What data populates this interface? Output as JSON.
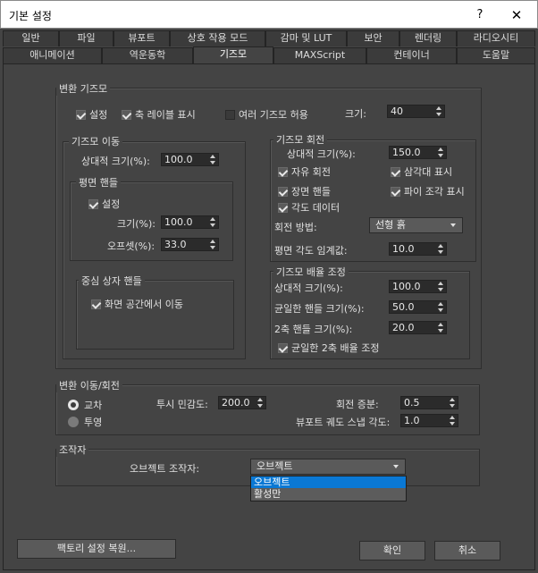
{
  "window": {
    "title": "기본 설정",
    "help_glyph": "?",
    "close_glyph": "✕"
  },
  "tabs_row1": [
    "일반",
    "파일",
    "뷰포트",
    "상호 작용 모드",
    "감마 및 LUT",
    "보안",
    "렌더링",
    "라디오시티"
  ],
  "tabs_row2": [
    "애니메이션",
    "역운동학",
    "기즈모",
    "MAXScript",
    "컨테이너",
    "도움말"
  ],
  "active_tab": "기즈모",
  "transform_gizmo": {
    "label": "변환 기즈모",
    "on_label": "설정",
    "on_checked": true,
    "axis_labels_label": "축 레이블 표시",
    "axis_labels_checked": true,
    "multiple_label": "여러 기즈모 허용",
    "multiple_checked": false,
    "size_label": "크기:",
    "size_value": "40"
  },
  "move_gizmo": {
    "label": "기즈모 이동",
    "relative_size_label": "상대적 크기(%):",
    "relative_size_value": "100.0",
    "plane_handles": {
      "label": "평면 핸들",
      "on_label": "설정",
      "on_checked": true,
      "size_label": "크기(%):",
      "size_value": "100.0",
      "offset_label": "오프셋(%):",
      "offset_value": "33.0"
    },
    "center_box": {
      "label": "중심 상자 핸들",
      "screen_space_label": "화면 공간에서 이동",
      "screen_space_checked": true
    }
  },
  "rotate_gizmo": {
    "label": "기즈모 회전",
    "relative_size_label": "상대적 크기(%):",
    "relative_size_value": "150.0",
    "free_rotation_label": "자유 회전",
    "free_rotation_checked": true,
    "show_triangle_label": "삼각대 표시",
    "show_triangle_checked": true,
    "screen_handle_label": "장면 핸들",
    "screen_handle_checked": true,
    "show_pie_label": "파이 조각 표시",
    "show_pie_checked": true,
    "angle_data_label": "각도 데이터",
    "angle_data_checked": true,
    "method_label": "회전 방법:",
    "method_value": "선형 흙",
    "plane_threshold_label": "평면 각도 임계값:",
    "plane_threshold_value": "10.0"
  },
  "scale_gizmo": {
    "label": "기즈모 배율 조정",
    "relative_size_label": "상대적 크기(%):",
    "relative_size_value": "100.0",
    "uniform_handle_label": "균일한 핸들 크기(%):",
    "uniform_handle_value": "50.0",
    "biaxial_handle_label": "2축 핸들 크기(%):",
    "biaxial_handle_value": "20.0",
    "uniform_biaxial_label": "균일한 2축 배율 조정",
    "uniform_biaxial_checked": true
  },
  "move_rotate_transforms": {
    "label": "변환 이동/회전",
    "intersection_label": "교차",
    "intersection_selected": true,
    "projection_label": "투영",
    "projection_selected": false,
    "perspective_sensitivity_label": "투시 민감도:",
    "perspective_sensitivity_value": "200.0",
    "rotation_increment_label": "회전 증분:",
    "rotation_increment_value": "0.5",
    "viewport_arc_snap_label": "뷰포트 궤도 스냅 각도:",
    "viewport_arc_snap_value": "1.0"
  },
  "manipulators": {
    "label": "조작자",
    "object_manipulators_label": "오브젝트 조작자:",
    "object_manipulators_value": "오브젝트",
    "options": [
      "오브젝트",
      "활성만"
    ],
    "highlighted_option": "오브젝트"
  },
  "buttons": {
    "revert_label": "팩토리 설정 복원...",
    "ok_label": "확인",
    "cancel_label": "취소"
  },
  "colors": {
    "panel_bg": "#444444",
    "field_bg": "#2b2b2b",
    "dropdown_bg": "#5a5a5a",
    "highlight": "#0a78d4"
  }
}
